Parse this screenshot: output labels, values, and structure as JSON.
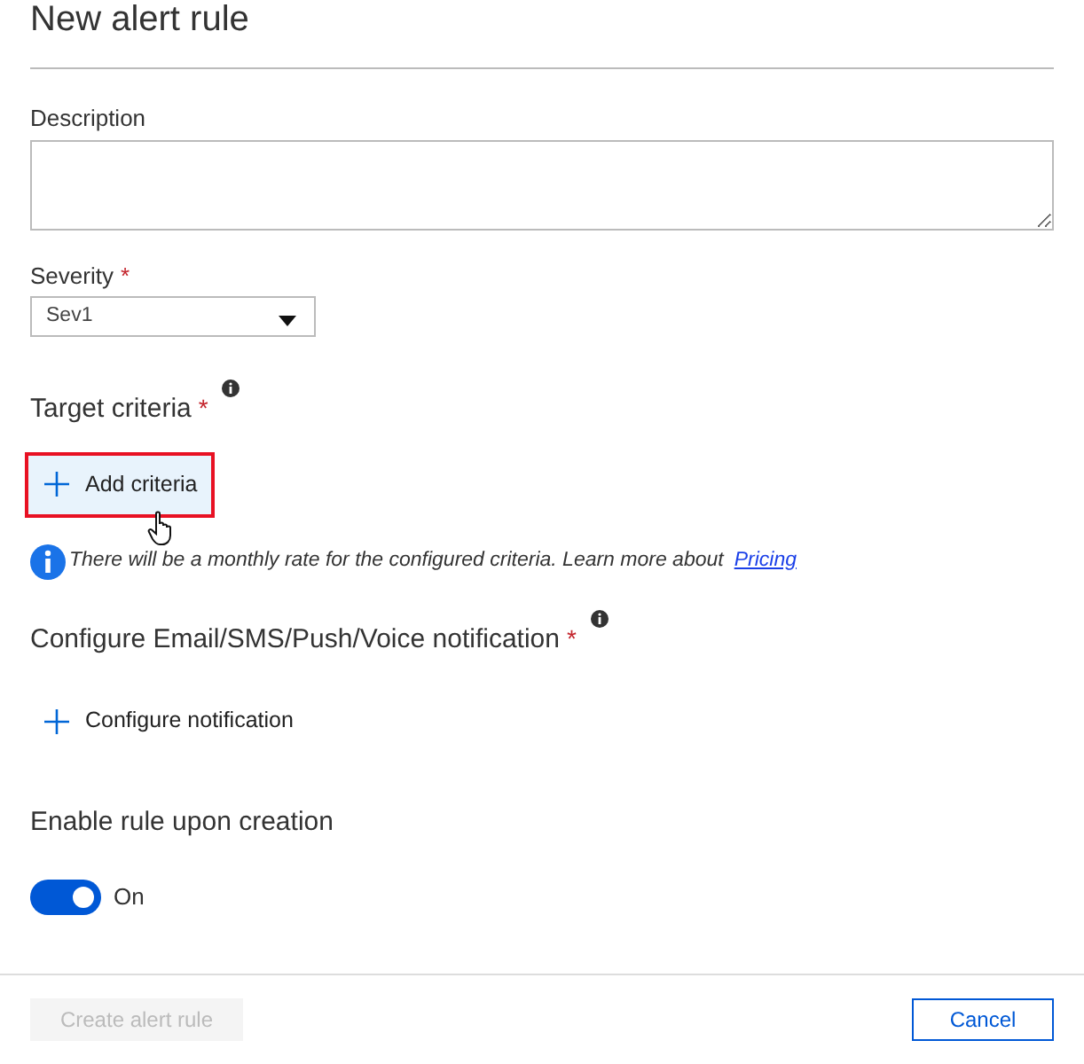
{
  "title": "New alert rule",
  "description": {
    "label": "Description"
  },
  "severity": {
    "label": "Severity",
    "required_mark": "*",
    "value": "Sev1"
  },
  "target": {
    "label": "Target criteria",
    "required_mark": "*",
    "add_button": {
      "label": "Add criteria",
      "highlighted": true
    },
    "note": "There will be a monthly rate for the configured criteria. Learn more about",
    "note_link": "Pricing"
  },
  "notification": {
    "label": "Configure Email/SMS/Push/Voice notification",
    "required_mark": "*",
    "add_button": {
      "label": "Configure notification",
      "highlighted": false
    }
  },
  "enable": {
    "label": "Enable rule upon creation",
    "on": true,
    "state_label": "On"
  },
  "footer": {
    "buttons": [
      {
        "label": "Create alert rule",
        "kind": "primary",
        "disabled": true
      },
      {
        "label": "Cancel",
        "kind": "secondary",
        "disabled": false
      }
    ]
  }
}
